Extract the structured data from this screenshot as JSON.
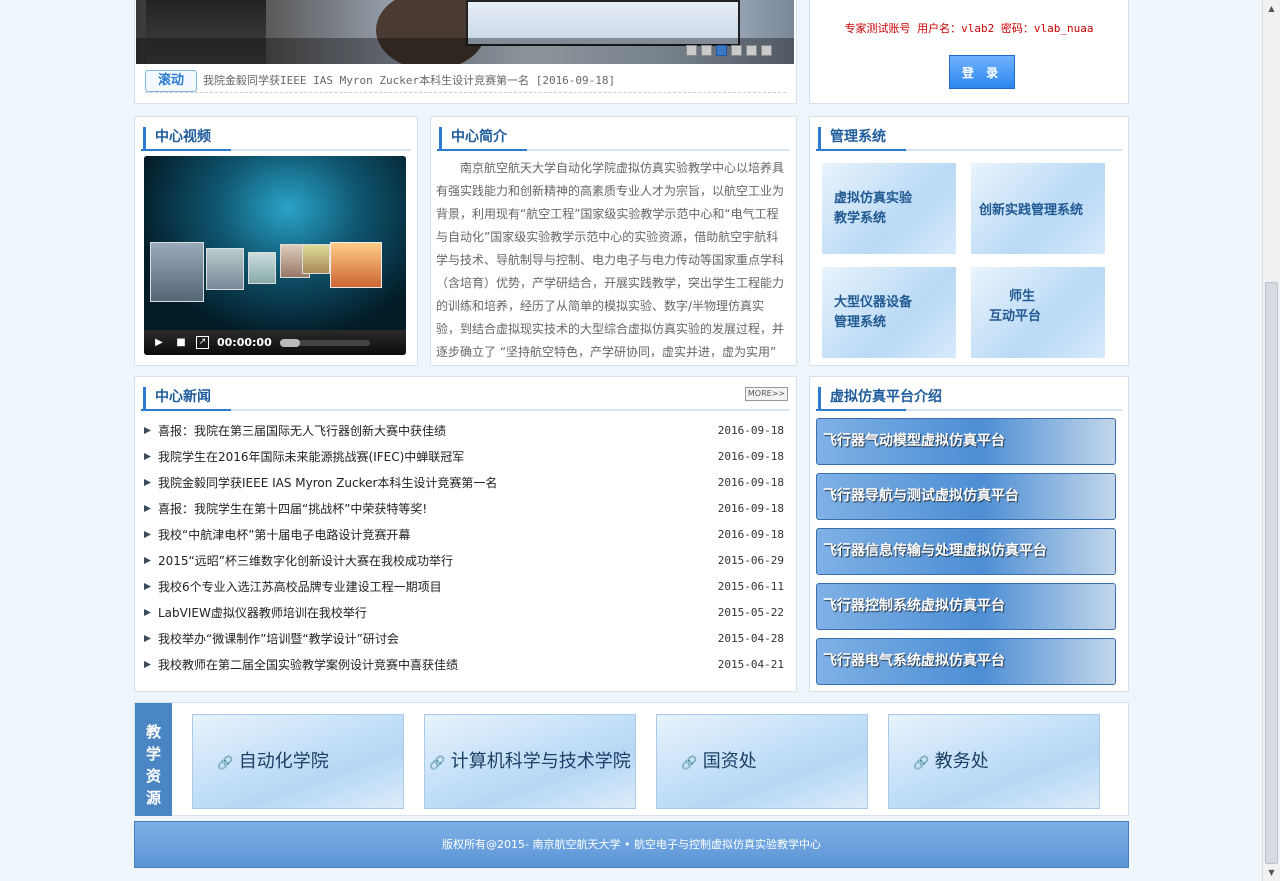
{
  "slideshow": {
    "dots": [
      false,
      false,
      true,
      false,
      false,
      false
    ],
    "scroll_tag": "滚动",
    "scroll_text": "我院金毅同学获IEEE IAS Myron Zucker本科生设计竞赛第一名 [2016-09-18]"
  },
  "login": {
    "account_info": "专家测试账号 用户名：vlab2 密码：vlab_nuaa",
    "button_label": "登 录"
  },
  "video": {
    "title": "中心视频",
    "time": "00:00:00"
  },
  "intro": {
    "title": "中心简介",
    "text": "南京航空航天大学自动化学院虚拟仿真实验教学中心以培养具有强实践能力和创新精神的高素质专业人才为宗旨，以航空工业为背景，利用现有“航空工程”国家级实验教学示范中心和“电气工程与自动化”国家级实验教学示范中心的实验资源，借助航空宇航科学与技术、导航制导与控制、电力电子与电力传动等国家重点学科（含培育）优势，产学研结合，开展实践教学，突出学生工程能力的训练和培养，经历了从简单的模拟实验、数字/半物理仿真实验，到结合虚拟现实技术的大型综合虚拟仿真实验的发展过程，并逐步确立了 “坚持航空特色，产学研协同，虚实并进，虚为实用”"
  },
  "management": {
    "title": "管理系统",
    "items": [
      {
        "line1": "虚拟仿真实验",
        "line2": "教学系统"
      },
      {
        "line1": "创新实践管理系统",
        "line2": ""
      },
      {
        "line1": "大型仪器设备",
        "line2": "管理系统"
      },
      {
        "line1": "师生",
        "line2": "互动平台"
      }
    ]
  },
  "news": {
    "title": "中心新闻",
    "more_label": "MORE>>",
    "items": [
      {
        "title": "喜报：我院在第三届国际无人飞行器创新大赛中获佳绩",
        "date": "2016-09-18"
      },
      {
        "title": "我院学生在2016年国际未来能源挑战赛(IFEC)中蝉联冠军",
        "date": "2016-09-18"
      },
      {
        "title": "我院金毅同学获IEEE IAS Myron Zucker本科生设计竞赛第一名",
        "date": "2016-09-18"
      },
      {
        "title": "喜报：我院学生在第十四届“挑战杯”中荣获特等奖!",
        "date": "2016-09-18"
      },
      {
        "title": "我校“中航津电杯”第十届电子电路设计竞赛开幕",
        "date": "2016-09-18"
      },
      {
        "title": "2015“远昭”杯三维数字化创新设计大赛在我校成功举行",
        "date": "2015-06-29"
      },
      {
        "title": "我校6个专业入选江苏高校品牌专业建设工程一期项目",
        "date": "2015-06-11"
      },
      {
        "title": "LabVIEW虚拟仪器教师培训在我校举行",
        "date": "2015-05-22"
      },
      {
        "title": "我校举办“微课制作”培训暨“教学设计”研讨会",
        "date": "2015-04-28"
      },
      {
        "title": "我校教师在第二届全国实验教学案例设计竞赛中喜获佳绩",
        "date": "2015-04-21"
      }
    ]
  },
  "platforms": {
    "title": "虚拟仿真平台介绍",
    "items": [
      "飞行器气动模型虚拟仿真平台",
      "飞行器导航与测试虚拟仿真平台",
      "飞行器信息传输与处理虚拟仿真平台",
      "飞行器控制系统虚拟仿真平台",
      "飞行器电气系统虚拟仿真平台"
    ]
  },
  "resources": {
    "label": "教学资源",
    "items": [
      "自动化学院",
      "计算机科学与技术学院",
      "国资处",
      "教务处"
    ]
  },
  "footer": {
    "text": "版权所有@2015- 南京航空航天大学 • 航空电子与控制虚拟仿真实验教学中心"
  },
  "colors": {
    "accent": "#2b7bd1",
    "account_text": "#cc0000"
  }
}
